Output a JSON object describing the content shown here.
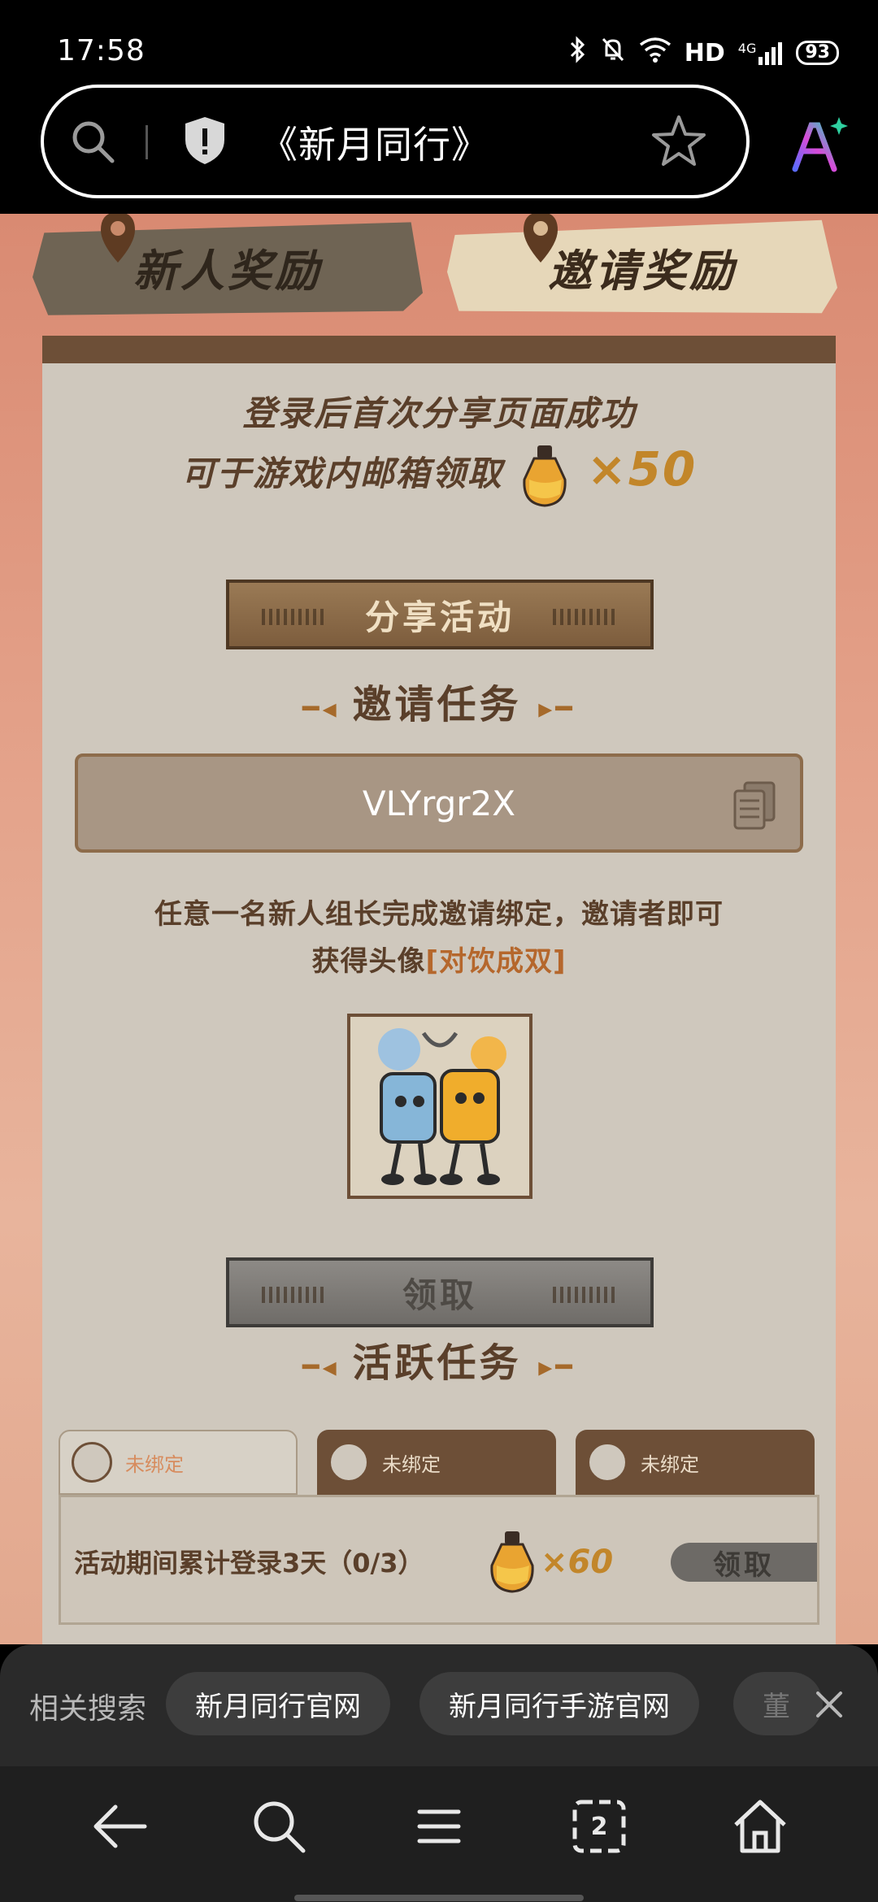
{
  "status_bar": {
    "time": "17:58",
    "hd": "HD",
    "network": "4G",
    "battery": "93"
  },
  "address_bar": {
    "title": "《新月同行》"
  },
  "page": {
    "tabs": {
      "new_reward": "新人奖励",
      "invite_reward": "邀请奖励"
    },
    "share_text_1": "登录后首次分享页面成功",
    "share_text_2_prefix": "可于游戏内邮箱领取",
    "share_reward_amount": "×50",
    "share_button": "分享活动",
    "invite_title": "邀请任务",
    "invite_code": "VLYrgr2X",
    "invite_desc_1": "任意一名新人组长完成邀请绑定，邀请者即可",
    "invite_desc_2_prefix": "获得头像",
    "invite_desc_2_highlight": "[对饮成双]",
    "claim_button": "领取",
    "active_title": "活跃任务",
    "task_tabs": [
      {
        "label": "未绑定"
      },
      {
        "label": "未绑定"
      },
      {
        "label": "未绑定"
      }
    ],
    "task_row": {
      "text": "活动期间累计登录3天（0/3）",
      "reward": "×60",
      "claim": "领取"
    }
  },
  "related_search": {
    "label": "相关搜索",
    "chips": [
      "新月同行官网",
      "新月同行手游官网",
      "董"
    ]
  },
  "bottom_nav": {
    "tab_count": "2"
  },
  "colors": {
    "accent_brown": "#6d4f37",
    "card_bg": "#cfc8bd",
    "highlight": "#b5672c"
  }
}
